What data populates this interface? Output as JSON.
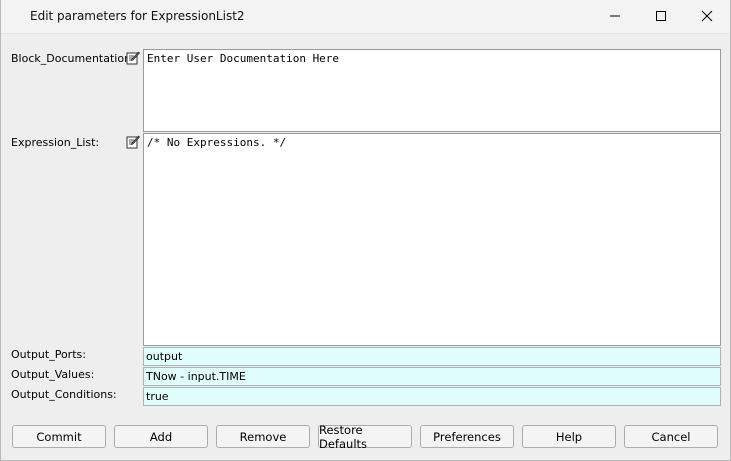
{
  "window": {
    "title": "Edit parameters for ExpressionList2",
    "controls": {
      "minimize": "minimize-icon",
      "maximize": "maximize-icon",
      "close": "close-icon"
    }
  },
  "params": {
    "block_documentation": {
      "label": "Block_Documentation:",
      "value": "Enter User Documentation Here"
    },
    "expression_list": {
      "label": "Expression_List:",
      "value": "/* No Expressions. */"
    },
    "output_ports": {
      "label": "Output_Ports:",
      "value": "output"
    },
    "output_values": {
      "label": "Output_Values:",
      "value": "TNow - input.TIME"
    },
    "output_conditions": {
      "label": "Output_Conditions:",
      "value": "true"
    }
  },
  "buttons": {
    "commit": "Commit",
    "add": "Add",
    "remove": "Remove",
    "restore_defaults": "Restore Defaults",
    "preferences": "Preferences",
    "help": "Help",
    "cancel": "Cancel"
  },
  "colors": {
    "field_bg": "#e0fcfc",
    "window_bg": "#eeeeee",
    "textarea_bg": "#ffffff"
  }
}
